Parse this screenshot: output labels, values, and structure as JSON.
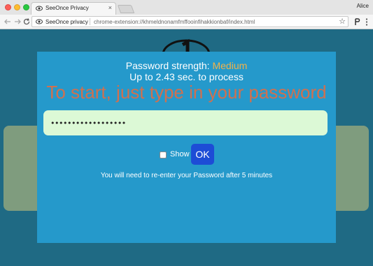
{
  "browser": {
    "tab_title": "SeeOnce Privacy",
    "tab_close": "×",
    "profile_name": "Alice",
    "omnibox_origin": "SeeOnce privacy",
    "omnibox_url": "chrome-extension://khmeldnonamfmffooinfihakkionbaf/index.html",
    "star": "☆"
  },
  "modal": {
    "strength_label": "Password strength: ",
    "strength_value": "Medium",
    "time_text": "Up to 2.43 sec. to process",
    "prompt": "To start, just type in your password",
    "password_value": "••••••••••••••••••",
    "show_label": "Show",
    "ok_label": "OK",
    "note": "You will need to re-enter your Password after 5 minutes"
  },
  "colors": {
    "page_bg": "#1f6a84",
    "modal_bg": "#2599cb",
    "strength_accent": "#f0b24a",
    "prompt_color": "#d0704f",
    "input_bg": "#dcf9d6",
    "ok_button": "#1d4cd6",
    "bg_panel": "#7f9c7e"
  }
}
